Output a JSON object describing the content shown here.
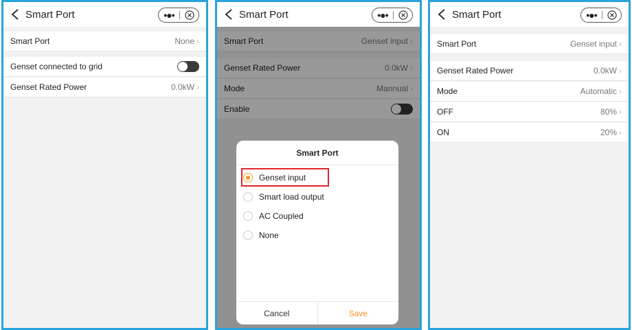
{
  "accent_color": "#29a3dc",
  "highlight_color": "#f7931e",
  "screens": [
    {
      "title": "Smart Port",
      "capsule": {
        "dots": "•●•",
        "close_icon": "close-circle-icon"
      },
      "rows": [
        {
          "label": "Smart Port",
          "value": "None"
        },
        {
          "label": "Genset connected to grid",
          "toggle": "off"
        },
        {
          "label": "Genset Rated Power",
          "value": "0.0kW"
        }
      ]
    },
    {
      "title": "Smart Port",
      "capsule": {
        "dots": "•●•",
        "close_icon": "close-circle-icon"
      },
      "rows": [
        {
          "label": "Smart Port",
          "value": "Genset input"
        },
        {
          "label": "Genset Rated Power",
          "value": "0.0kW"
        },
        {
          "label": "Mode",
          "value": "Mannual"
        },
        {
          "label": "Enable",
          "toggle": "off"
        }
      ],
      "dialog": {
        "title": "Smart Port",
        "options": [
          {
            "label": "Genset input",
            "selected": true
          },
          {
            "label": "Smart load output",
            "selected": false
          },
          {
            "label": "AC Coupled",
            "selected": false
          },
          {
            "label": "None",
            "selected": false
          }
        ],
        "cancel_label": "Cancel",
        "save_label": "Save"
      }
    },
    {
      "title": "Smart Port",
      "capsule": {
        "dots": "•●•",
        "close_icon": "close-circle-icon"
      },
      "rows": [
        {
          "label": "Smart Port",
          "value": "Genset input"
        },
        {
          "label": "Genset Rated Power",
          "value": "0.0kW"
        },
        {
          "label": "Mode",
          "value": "Automatic"
        },
        {
          "label": "OFF",
          "value": "80%"
        },
        {
          "label": "ON",
          "value": "20%"
        }
      ]
    }
  ],
  "chevron": "›"
}
